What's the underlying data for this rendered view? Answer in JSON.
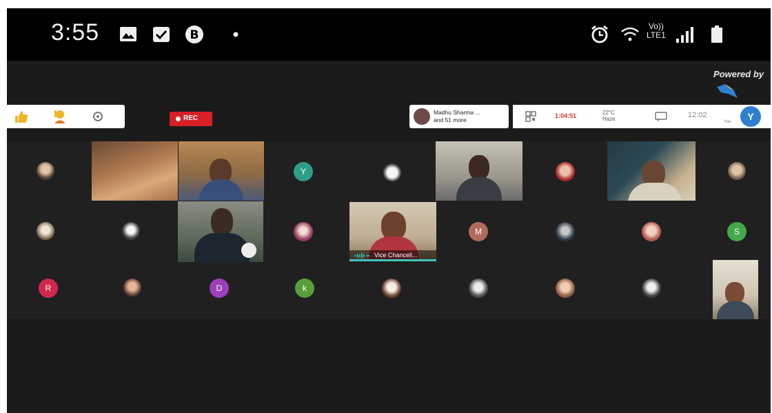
{
  "status_bar": {
    "time": "3:55",
    "icons": [
      "image-icon",
      "calendar-check-icon",
      "b-circle-icon",
      "dot-icon",
      "alarm-icon",
      "wifi-icon",
      "volte-icon",
      "signal-icon",
      "battery-icon"
    ],
    "volte_top": "Vo))",
    "volte_bottom": "LTE1"
  },
  "meeting": {
    "powered_by": "Powered by",
    "rec_label": "REC",
    "participants_line1": "Madhu Sharma ...",
    "participants_line2": "and 51 more",
    "timer": "1:04:51",
    "weather_top": "22°C",
    "weather_bottom": "Haze",
    "clock": "12:02",
    "you_label": "You",
    "you_initial": "Y"
  },
  "tiles": {
    "row2_letter_y": "Y",
    "row2_letter_m": "M",
    "row2_letter_s": "S",
    "row3_letter_r": "R",
    "row3_letter_d": "D",
    "row3_letter_k": "k",
    "vc_label": "Vice Chancell..."
  },
  "colors": {
    "letter_y": "#2f9e88",
    "letter_m": "#b36a5e",
    "letter_s": "#45a84a",
    "letter_r": "#d1284e",
    "letter_d": "#9d3fb8",
    "letter_k": "#5a9e3c",
    "rec": "#d81f26",
    "accent": "#3fc7c2"
  }
}
